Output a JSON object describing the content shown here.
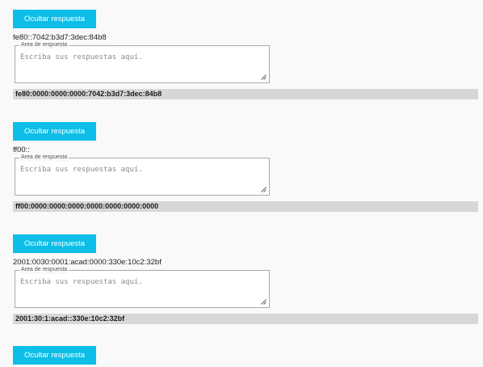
{
  "items": [
    {
      "button_label": "Ocultar respuesta",
      "question": "fe80::7042:b3d7:3dec:84b8",
      "legend": "Area de respuesta",
      "placeholder": "Escriba sus respuestas aquí.",
      "solution": "fe80:0000:0000:0000:7042:b3d7:3dec:84b8"
    },
    {
      "button_label": "Ocultar respuesta",
      "question": "ff00::",
      "legend": "Area de respuesta",
      "placeholder": "Escriba sus respuestas aquí.",
      "solution": "ff00:0000:0000:0000:0000:0000:0000:0000"
    },
    {
      "button_label": "Ocultar respuesta",
      "question": "2001:0030:0001:acad:0000:330e:10c2:32bf",
      "legend": "Area de respuesta",
      "placeholder": "Escriba sus respuestas aquí.",
      "solution": "2001:30:1:acad::330e:10c2:32bf"
    },
    {
      "button_label": "Ocultar respuesta"
    }
  ],
  "colors": {
    "button_bg": "#0dbfe8",
    "button_text": "#ffffff",
    "solution_bg": "#d7d7d7",
    "page_bg": "#f9f9f9"
  }
}
